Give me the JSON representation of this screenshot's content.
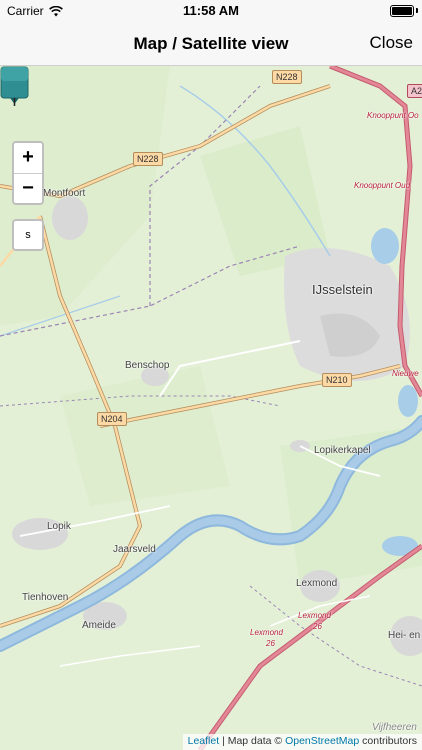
{
  "status": {
    "carrier": "Carrier",
    "time": "11:58 AM",
    "battery_level": 1.0
  },
  "nav": {
    "title": "Map / Satellite view",
    "close_label": "Close"
  },
  "map": {
    "zoom_in": "+",
    "zoom_out": "−",
    "layer_button": "s",
    "roads": {
      "n228_a": "N228",
      "n228_b": "N228",
      "n210": "N210",
      "n204": "N204",
      "a2": "A2"
    },
    "places": {
      "montfoort": "Montfoort",
      "ijsselstein": "IJsselstein",
      "benschop": "Benschop",
      "lopikerkapel": "Lopikerkapel",
      "lopik": "Lopik",
      "jaarsveld": "Jaarsveld",
      "tienhoven": "Tienhoven",
      "ameide": "Ameide",
      "lexmond": "Lexmond",
      "hei_en": "Hei- en B",
      "vianen": "Vijfheeren"
    },
    "junctions": {
      "knooppunt1": "Knooppunt Oo",
      "knooppunt2": "Knooppunt Oud",
      "nieuwe": "Nieuwe",
      "lexmond_exit": "Lexmond",
      "exit_num_a": "26",
      "lexmond_exit2": "Lexmond",
      "exit_num_b": "26"
    },
    "attribution": {
      "leaflet": "Leaflet",
      "sep": " | Map data © ",
      "osm": "OpenStreetMap",
      "contrib": " contributors"
    }
  },
  "colors": {
    "accent": "#2f8e91",
    "river": "#9fc3e6",
    "road_major": "#fcd9a5",
    "motorway": "#e38797"
  }
}
